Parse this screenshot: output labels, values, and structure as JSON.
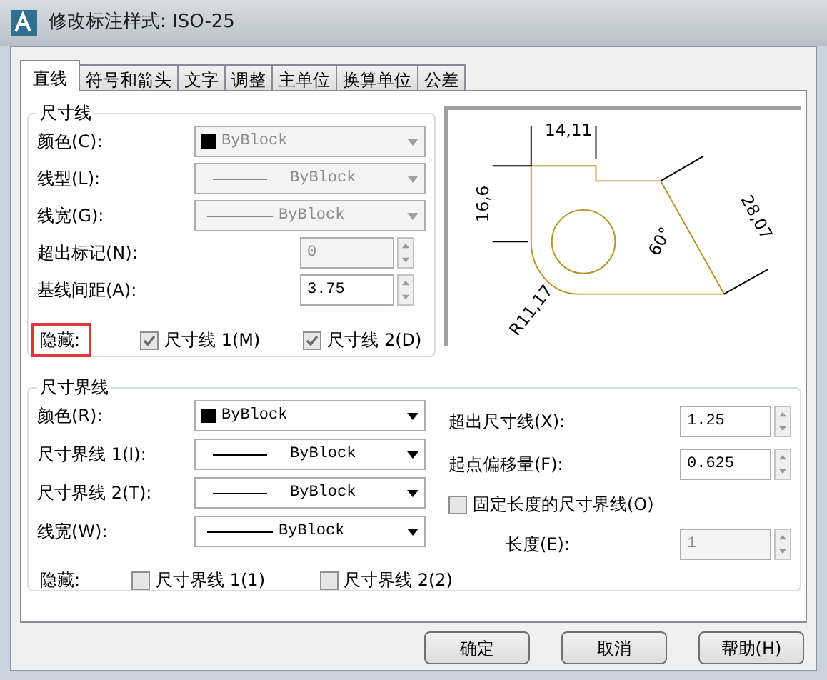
{
  "window": {
    "title": "修改标注样式: ISO-25"
  },
  "tabs": [
    {
      "label": "直线",
      "selected": true
    },
    {
      "label": "符号和箭头",
      "selected": false
    },
    {
      "label": "文字",
      "selected": false
    },
    {
      "label": "调整",
      "selected": false
    },
    {
      "label": "主单位",
      "selected": false
    },
    {
      "label": "换算单位",
      "selected": false
    },
    {
      "label": "公差",
      "selected": false
    }
  ],
  "dimension_lines": {
    "title": "尺寸线",
    "rows": [
      {
        "kind": "color",
        "label": "颜色(C):",
        "value": "ByBlock",
        "disabled": true
      },
      {
        "kind": "linetype",
        "label": "线型(L):",
        "value": "ByBlock",
        "disabled": true
      },
      {
        "kind": "lineweight",
        "label": "线宽(G):",
        "value": "ByBlock",
        "disabled": true
      },
      {
        "kind": "spinner",
        "label": "超出标记(N):",
        "value": "0",
        "disabled": true
      },
      {
        "kind": "spinner",
        "label": "基线间距(A):",
        "value": "3.75",
        "disabled": false
      }
    ],
    "hide": {
      "label": "隐藏:",
      "highlighted": true,
      "options": [
        {
          "label": "尺寸线 1(M)",
          "checked": true
        },
        {
          "label": "尺寸线 2(D)",
          "checked": true
        }
      ]
    }
  },
  "preview": {
    "labels": [
      "14,11",
      "16,6",
      "28,07",
      "60°",
      "R11,17"
    ]
  },
  "extension_lines": {
    "title": "尺寸界线",
    "rows": [
      {
        "kind": "color",
        "label": "颜色(R):",
        "value": "ByBlock",
        "disabled": false
      },
      {
        "kind": "linetype",
        "label": "尺寸界线 1(I):",
        "value": "ByBlock",
        "disabled": false
      },
      {
        "kind": "linetype",
        "label": "尺寸界线 2(T):",
        "value": "ByBlock",
        "disabled": false
      },
      {
        "kind": "lineweight",
        "label": "线宽(W):",
        "value": "ByBlock",
        "disabled": false
      }
    ],
    "hide": {
      "label": "隐藏:",
      "highlighted": false,
      "options": [
        {
          "label": "尺寸界线 1(1)",
          "checked": false
        },
        {
          "label": "尺寸界线 2(2)",
          "checked": false
        }
      ]
    },
    "right_rows": [
      {
        "kind": "spinner",
        "label": "超出尺寸线(X):",
        "value": "1.25",
        "disabled": false
      },
      {
        "kind": "spinner",
        "label": "起点偏移量(F):",
        "value": "0.625",
        "disabled": false
      },
      {
        "kind": "checkbox",
        "label": "固定长度的尺寸界线(O)",
        "checked": false
      },
      {
        "kind": "spinner",
        "label": "长度(E):",
        "value": "1",
        "disabled": true
      }
    ]
  },
  "buttons": [
    "确定",
    "取消",
    "帮助(H)"
  ]
}
